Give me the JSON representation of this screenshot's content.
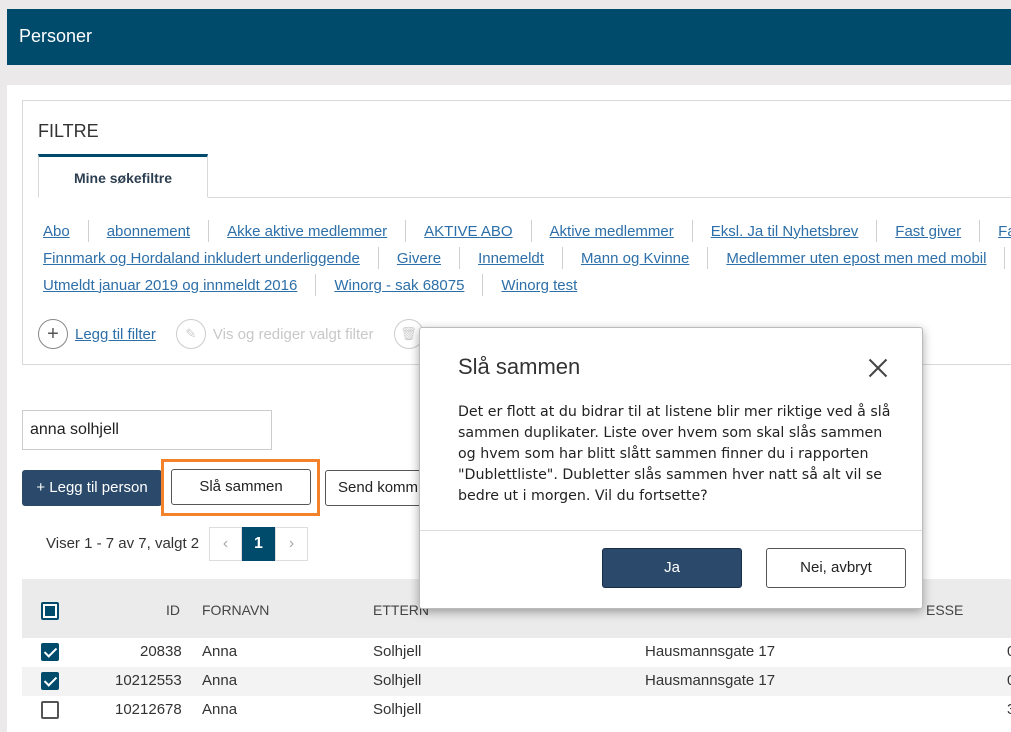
{
  "header": {
    "title": "Personer"
  },
  "filters": {
    "title": "FILTRE",
    "tab_label": "Mine søkefiltre",
    "rows": [
      [
        "Abo",
        "abonnement",
        "Akke aktive medlemmer",
        "AKTIVE ABO",
        "Aktive medlemmer",
        "Eksl. Ja til Nyhetsbrev",
        "Fast giver",
        "Fa"
      ],
      [
        "Finnmark og Hordaland inkludert underliggende",
        "Givere",
        "Innemeldt",
        "Mann og Kvinne",
        "Medlemmer uten epost men med mobil"
      ],
      [
        "Utmeldt januar 2019 og innmeldt 2016",
        "Winorg - sak 68075",
        "Winorg test"
      ]
    ],
    "actions": {
      "add_label": "Legg til filter",
      "edit_label": "Vis og rediger valgt filter"
    }
  },
  "search": {
    "value": "anna solhjell"
  },
  "toolbar": {
    "add_person": "+ Legg til person",
    "merge": "Slå sammen",
    "send": "Send komm"
  },
  "paging": {
    "text": "Viser 1 - 7 av 7, valgt 2",
    "page": "1",
    "prev": "‹",
    "next": "›"
  },
  "table": {
    "headers": {
      "id": "ID",
      "firstname": "FORNAVN",
      "lastname": "ETTERN",
      "address": "ESSE"
    },
    "rows": [
      {
        "checked": true,
        "id": "20838",
        "firstname": "Anna",
        "lastname": "Solhjell",
        "address": "Hausmannsgate 17",
        "extra": "0"
      },
      {
        "checked": true,
        "id": "10212553",
        "firstname": "Anna",
        "lastname": "Solhjell",
        "address": "Hausmannsgate 17",
        "extra": "0"
      },
      {
        "checked": false,
        "id": "10212678",
        "firstname": "Anna",
        "lastname": "Solhjell",
        "address": "",
        "extra": "3"
      }
    ]
  },
  "modal": {
    "title": "Slå sammen",
    "body": "Det er flott at du bidrar til at listene blir mer riktige ved å slå sammen duplikater. Liste over hvem som skal slås sammen og hvem som har blitt slått sammen finner du i rapporten \"Dublettliste\". Dubletter slås sammen hver natt så alt vil se bedre ut i morgen. Vil du fortsette?",
    "yes": "Ja",
    "no": "Nei, avbryt"
  }
}
